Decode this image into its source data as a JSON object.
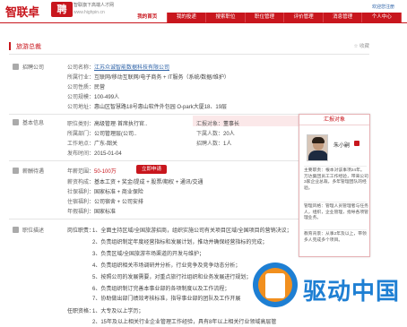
{
  "brand": {
    "name": "智联卓",
    "badge": "聘",
    "slogan": "智联旗下高端人才网",
    "domain": "www.highpin.cn",
    "link1": "欢迎您注册",
    "link2": "推荐职位·我们"
  },
  "nav": [
    "我的首页",
    "我的投递",
    "搜索职位",
    "职位管理",
    "评价管理",
    "消息管理",
    "个人中心"
  ],
  "page": {
    "title": "旅游总裁",
    "fav": "收藏"
  },
  "company": {
    "section": "招聘公司",
    "name_k": "公司名称：",
    "name_v": "江苏众诚智能数据科技有限公司",
    "industry_k": "所属行业：",
    "industry_v": "互联网/移动互联网/电子商务 + IT服务（系统/数据/维护）",
    "nature_k": "公司性质：",
    "nature_v": "民营",
    "size_k": "公司规模：",
    "size_v": "100-499人",
    "addr_k": "公司地址：",
    "addr_v": "惠山区智慧路18号惠山软件外包园 O-park大厦18、19层"
  },
  "basic": {
    "section": "基本信息",
    "type_k": "职位类别：",
    "type_v": "高级管理·首席执行官..",
    "dept_k": "所属部门：",
    "dept_v": "公司管理层(公司..",
    "workplace_k": "工作地点：",
    "workplace_v": "广东-韶关",
    "date_k": "发布时间：",
    "date_v": "2015-01-04",
    "report_k": "汇报对象：",
    "report_v": "董事长",
    "sub_k": "下属人数：",
    "sub_v": "20人",
    "count_k": "招聘人数：",
    "count_v": "1人"
  },
  "salary": {
    "section": "薪酬待遇",
    "k": "年薪范围：",
    "v": "50-100万",
    "btn": "立即申请",
    "benefit_k": "基本工资 + 奖金/提成 + 股票/期权 + 通讯/交通",
    "social_k": "社保福利：",
    "social_v": "国家标准 + 商业保险",
    "live_k": "住宿福利：",
    "live_v": "公司宿舍 + 公司安排",
    "annual_k": "年假福利：",
    "annual_v": "国家标准"
  },
  "duty": {
    "section": "职位描述",
    "intro": "岗位职责：",
    "items": [
      "1、全面主持区域/全国旅游招商，组织实施公司有关项目区域/全国项目的营销决议；",
      "2、负责组织制定年度经营指标和发展计划，推动并确保经营指标的完成；",
      "3、负责区域/全国旅游市场渠道的开发与维护；",
      "4、负责组织相关市场调研并分析，行业竞争及竞争动态分析；",
      "5、按照公司的发展需要，对重点旅行社组织和业务发展进行规划；",
      "6、负责组织制订完善本事业部的各项制度以及工作流程；",
      "7、协助做出部门绩效考核标准，指导事业部的团队及工作开展"
    ],
    "req": "任职资格：",
    "req1": "1、大专及以上学历；",
    "req2": "2、15年及以上相关行业企业管理工作经验，具有8年以上相关行业领域高层管"
  },
  "card": {
    "title": "汇报对象",
    "name": "朱小嗣",
    "desc1": "主要职责：根本对该事项24年。万达集团员工工作经验，带来公司3家企业总裁，多年管理团队的经验。",
    "desc2": "管理风格：管理人员管理者与任务人，组织，企业管理，指导各项管理业务。",
    "desc3": "教育背景：从事2年及以上，带领多人完成多个项目。"
  },
  "watermark": {
    "text": "驱动中国",
    "tag": "驱动中国"
  }
}
